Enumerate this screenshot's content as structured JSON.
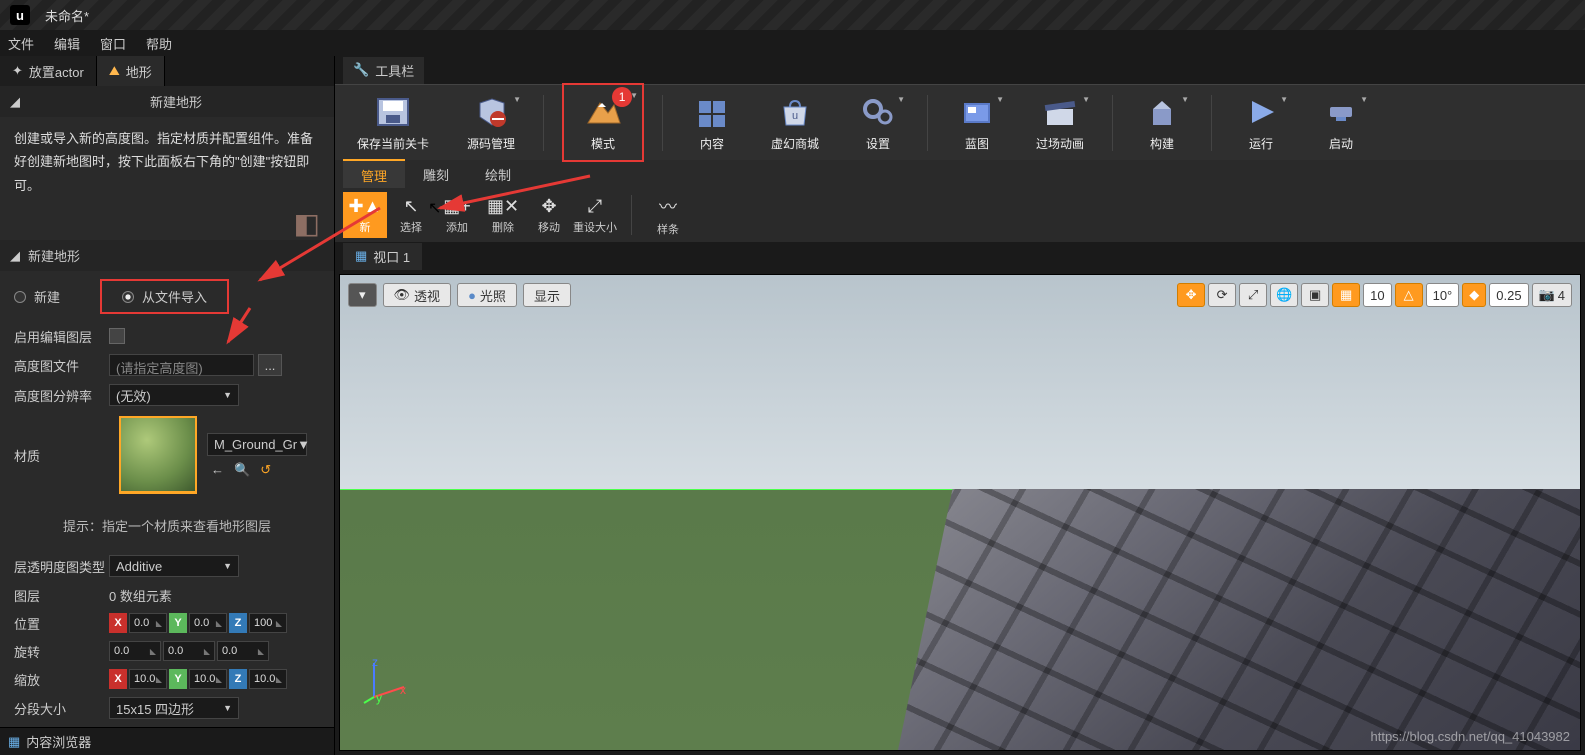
{
  "titlebar": {
    "logo": "u",
    "title": "未命名*"
  },
  "menubar": {
    "file": "文件",
    "edit": "编辑",
    "window": "窗口",
    "help": "帮助"
  },
  "left": {
    "tab_place": "放置actor",
    "tab_landscape": "地形",
    "new_landscape": "新建地形",
    "desc": "创建或导入新的高度图。指定材质并配置组件。准备好创建新地图时，按下此面板右下角的\"创建\"按钮即可。",
    "radio_new": "新建",
    "radio_import": "从文件导入",
    "enable_edit": "启用编辑图层",
    "heightmap_file": "高度图文件",
    "heightmap_placeholder": "(请指定高度图)",
    "browse": "...",
    "heightmap_res": "高度图分辨率",
    "res_value": "(无效)",
    "material": "材质",
    "mat_name": "M_Ground_Gr",
    "hint": "提示：指定一个材质来查看地形图层",
    "layer_alpha": "层透明度图类型",
    "layer_alpha_val": "Additive",
    "layers": "图层",
    "layers_val": "0 数组元素",
    "location": "位置",
    "rotation": "旋转",
    "scale": "缩放",
    "section_size": "分段大小",
    "section_val": "15x15 四边形",
    "v0": "0.0",
    "v1": "10.0",
    "v100": "100",
    "content_browser": "内容浏览器"
  },
  "toolbar": {
    "tab": "工具栏",
    "save": "保存当前关卡",
    "source": "源码管理",
    "modes": "模式",
    "content": "内容",
    "marketplace": "虚幻商城",
    "settings": "设置",
    "blueprints": "蓝图",
    "cinematics": "过场动画",
    "build": "构建",
    "play": "运行",
    "launch": "启动",
    "badge": "1"
  },
  "subtabs": {
    "manage": "管理",
    "sculpt": "雕刻",
    "paint": "绘制"
  },
  "modetools": {
    "new": "新",
    "select": "选择",
    "add": "添加",
    "delete": "删除",
    "move": "移动",
    "resize": "重设大小",
    "spline": "样条"
  },
  "viewport": {
    "tab": "视口 1",
    "perspective": "透视",
    "lit": "光照",
    "show": "显示",
    "snap_move": "10",
    "snap_rot": "10°",
    "snap_scale": "0.25",
    "cam_speed": "4",
    "gizmo": {
      "x": "x",
      "y": "y",
      "z": "z"
    }
  },
  "watermark": "https://blog.csdn.net/qq_41043982"
}
